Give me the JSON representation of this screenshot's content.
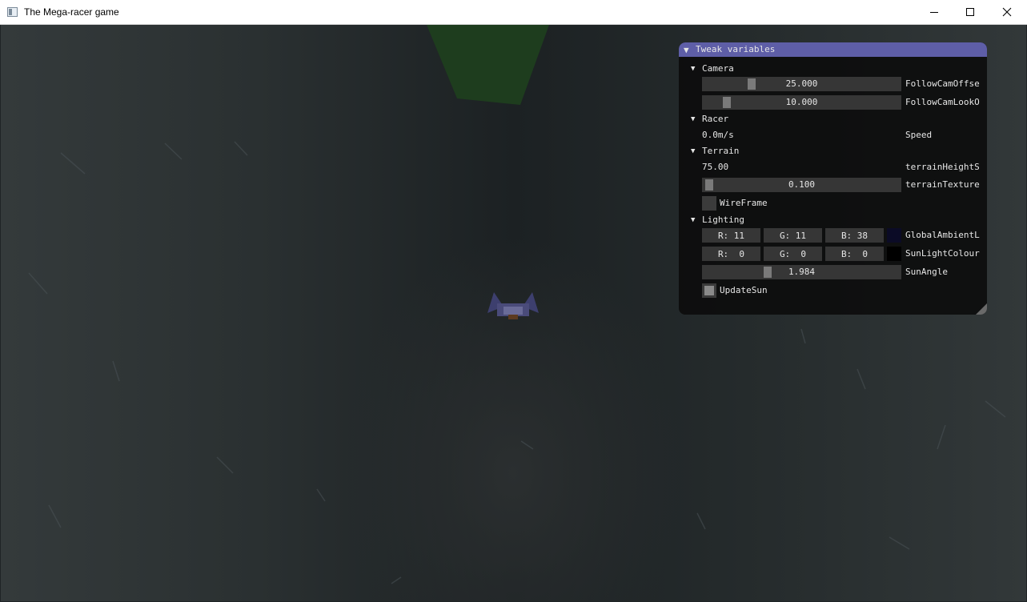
{
  "window": {
    "title": "The Mega-racer game",
    "icons": {
      "app": "app-icon",
      "minimize": "minimize-icon",
      "maximize": "maximize-icon",
      "close": "close-icon"
    }
  },
  "tweak_panel": {
    "title": "Tweak variables",
    "colors": {
      "header": "#5e5ea7",
      "background": "#0a0a0a",
      "frame": "#363636",
      "grab": "#7a7a7a"
    },
    "camera": {
      "label": "Camera",
      "follow_cam_offset": {
        "value": "25.000",
        "label": "FollowCamOffse"
      },
      "follow_cam_look": {
        "value": "10.000",
        "label": "FollowCamLookO"
      }
    },
    "racer": {
      "label": "Racer",
      "speed": {
        "value": "0.0m/s",
        "label": "Speed"
      }
    },
    "terrain": {
      "label": "Terrain",
      "height": {
        "value": "75.00",
        "label": "terrainHeightS"
      },
      "texture": {
        "value": "0.100",
        "label": "terrainTexture"
      },
      "wireframe": {
        "label": "WireFrame",
        "checked": false
      }
    },
    "lighting": {
      "label": "Lighting",
      "global_ambient": {
        "r": "R: 11",
        "g": "G: 11",
        "b": "B: 38",
        "label": "GlobalAmbientL",
        "swatch": "#0b0b26"
      },
      "sun_light": {
        "r": "R:  0",
        "g": "G:  0",
        "b": "B:  0",
        "label": "SunLightColour",
        "swatch": "#000000"
      },
      "sun_angle": {
        "value": "1.984",
        "label": "SunAngle"
      },
      "update_sun": {
        "label": "UpdateSun",
        "checked": true
      }
    }
  },
  "scene": {
    "sky_color": "#1e3d1e",
    "grass_color": "#2c3234"
  }
}
